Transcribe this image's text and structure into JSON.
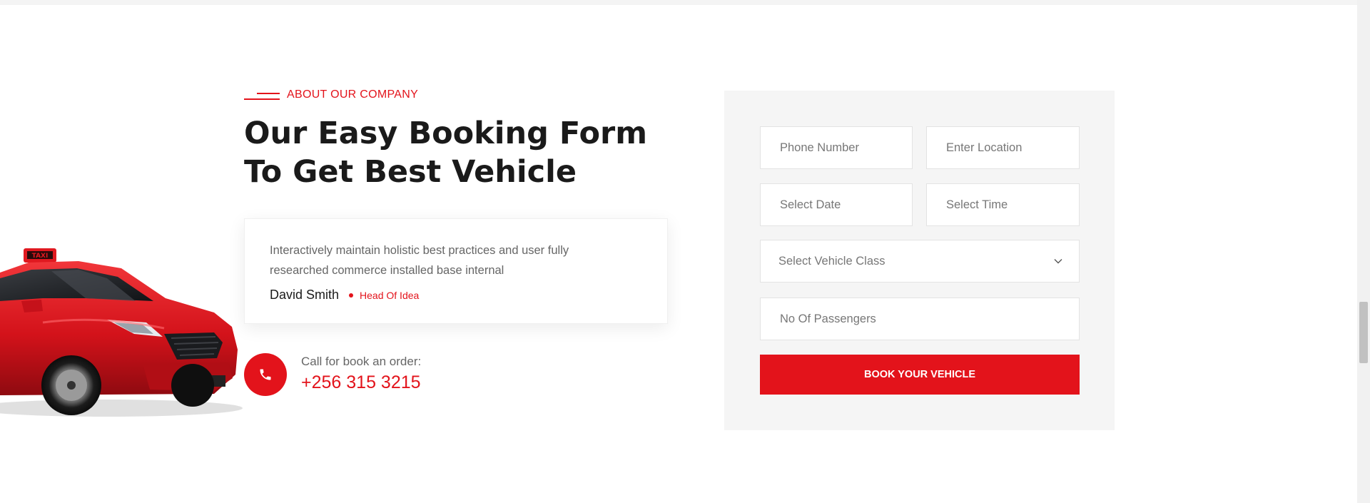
{
  "about": {
    "eyebrow": "ABOUT OUR COMPANY",
    "heading_line1": "Our Easy Booking Form",
    "heading_line2": "To Get Best Vehicle"
  },
  "testimonial": {
    "text": "Interactively maintain holistic best practices and user fully researched commerce installed base internal",
    "author": "David Smith",
    "role": "Head Of Idea"
  },
  "call": {
    "label": "Call for book an order:",
    "number": "+256 315 3215"
  },
  "car": {
    "sign": "TAXI"
  },
  "form": {
    "phone_placeholder": "Phone Number",
    "location_placeholder": "Enter Location",
    "date_placeholder": "Select Date",
    "time_placeholder": "Select Time",
    "vehicle_class": "Select Vehicle Class",
    "passengers_placeholder": "No Of Passengers",
    "submit_label": "BOOK YOUR VEHICLE"
  },
  "colors": {
    "accent": "#e3131b",
    "heading": "#1a1a1a",
    "panel_bg": "#f5f5f5"
  }
}
